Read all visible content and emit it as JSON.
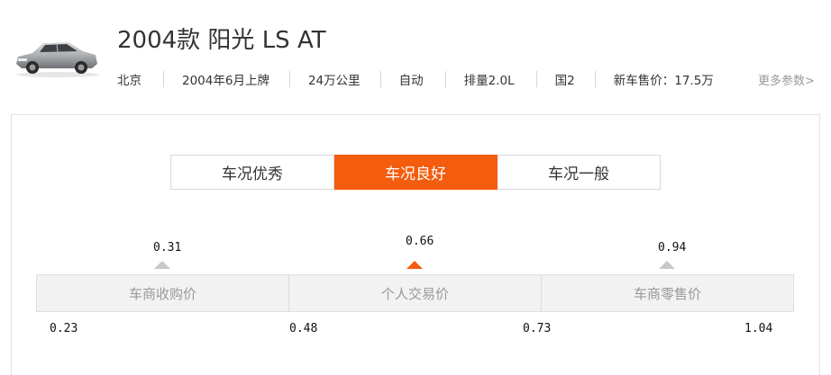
{
  "car": {
    "title": "2004款 阳光 LS AT",
    "thumbnail_icon": "car-photo",
    "specs": [
      "北京",
      "2004年6月上牌",
      "24万公里",
      "自动",
      "排量2.0L",
      "国2",
      "新车售价：17.5万"
    ],
    "more_link": "更多参数>"
  },
  "condition_tabs": {
    "labels": [
      "车况优秀",
      "车况良好",
      "车况一般"
    ],
    "selected": "车况良好"
  },
  "price_levels": [
    {
      "label": "车商收购价",
      "value": "0.31",
      "active": false
    },
    {
      "label": "个人交易价",
      "value": "0.66",
      "active": true
    },
    {
      "label": "车商零售价",
      "value": "0.94",
      "active": false
    }
  ],
  "price_boundaries": [
    "0.23",
    "0.48",
    "0.73",
    "1.04"
  ],
  "colors": {
    "accent": "#f45c0e",
    "inactive_marker": "#c8c8c8",
    "bar_bg": "#f2f2f2",
    "muted_text": "#999999"
  }
}
